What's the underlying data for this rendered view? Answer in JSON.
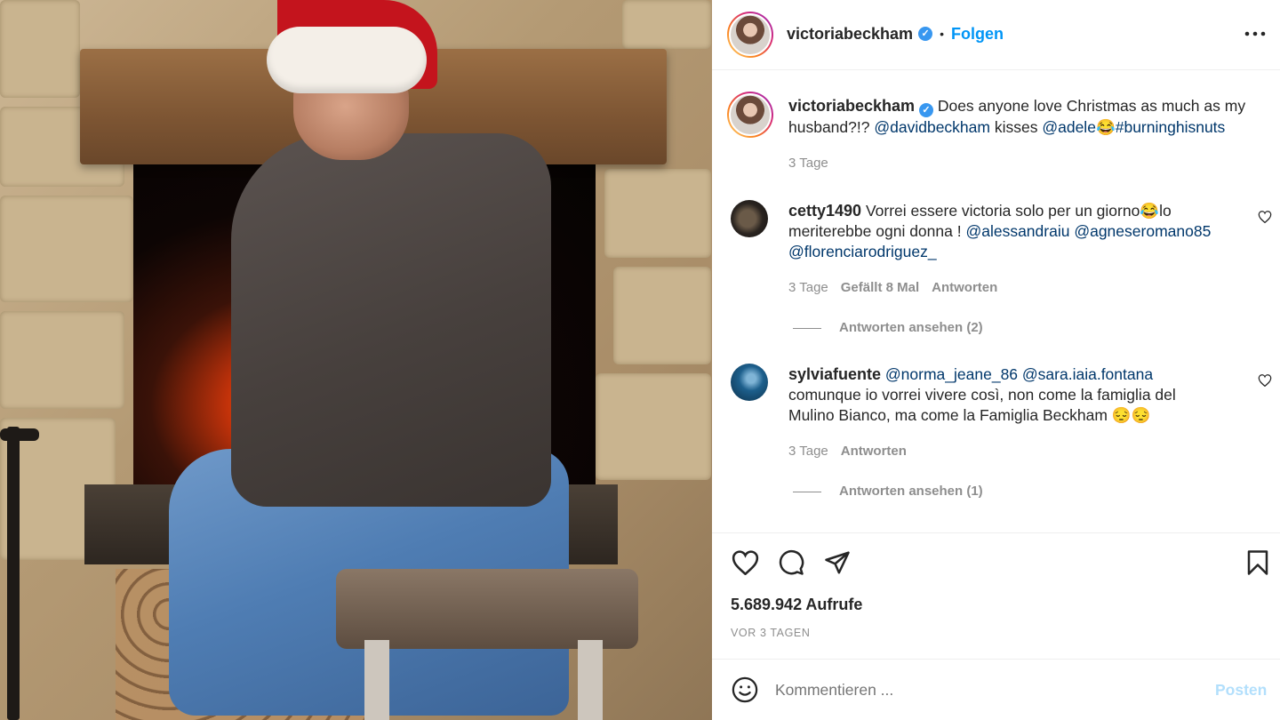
{
  "header": {
    "username": "victoriabeckham",
    "separator": "•",
    "follow_label": "Folgen",
    "more_icon": "more-options-icon"
  },
  "caption": {
    "username": "victoriabeckham",
    "text_1": "Does anyone love Christmas as much as my",
    "text_2a": "husband?!?",
    "mention_1": "@davidbeckham",
    "text_2b": "kisses",
    "mention_2": "@adele",
    "emoji": "😂",
    "hashtag": "#burninghisnuts",
    "time": "3 Tage"
  },
  "comments": [
    {
      "username": "cetty1490",
      "text_1": "Vorrei essere victoria solo per un giorno😂lo",
      "text_2": "meriterebbe ogni donna !",
      "mention_1": "@alessandraiu",
      "mention_2": "@agneseromano85",
      "mention_3": "@florenciarodriguez_",
      "time": "3 Tage",
      "likes": "Gefällt 8 Mal",
      "reply": "Antworten",
      "view_replies": "Antworten ansehen (2)"
    },
    {
      "username": "sylviafuente",
      "mention_1": "@norma_jeane_86",
      "mention_2": "@sara.iaia.fontana",
      "text_1": "comunque io vorrei vivere così, non come la famiglia del",
      "text_2": "Mulino Bianco, ma come la Famiglia Beckham 😔😔",
      "time": "3 Tage",
      "reply": "Antworten",
      "view_replies": "Antworten ansehen (1)"
    }
  ],
  "actions": {
    "views": "5.689.942 Aufrufe",
    "date": "VOR 3 TAGEN"
  },
  "composer": {
    "placeholder": "Kommentieren ...",
    "post_label": "Posten"
  },
  "colors": {
    "accent": "#0095f6",
    "text": "#262626",
    "muted": "#8e8e8e",
    "mention": "#00376b",
    "post_disabled": "#b2dffc"
  }
}
